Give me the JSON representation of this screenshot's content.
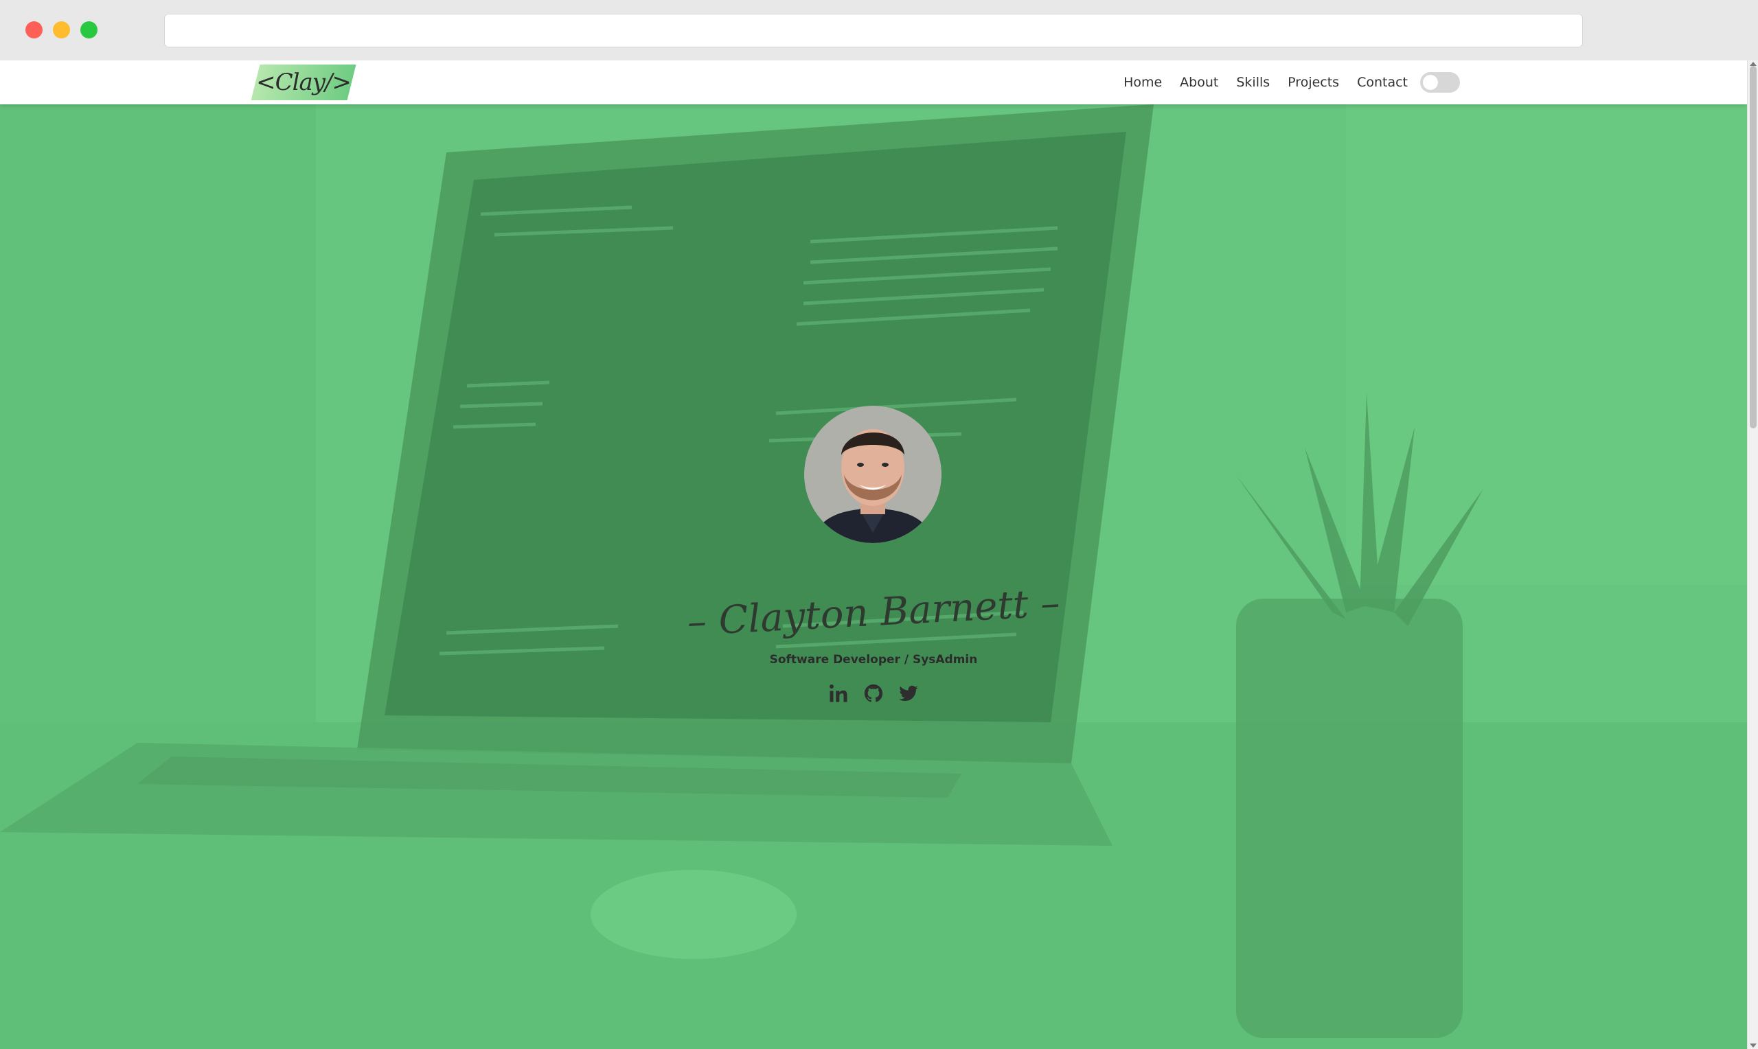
{
  "browser": {
    "address_value": "",
    "address_placeholder": ""
  },
  "navbar": {
    "logo_text": "<Clay/>",
    "links": [
      "Home",
      "About",
      "Skills",
      "Projects",
      "Contact"
    ],
    "theme_toggle": {
      "state": "off"
    }
  },
  "hero": {
    "name": "– Clayton Barnett –",
    "role": "Software Developer / SysAdmin",
    "socials": [
      {
        "name": "linkedin",
        "icon": "linkedin-icon"
      },
      {
        "name": "github",
        "icon": "github-icon"
      },
      {
        "name": "twitter",
        "icon": "twitter-icon"
      }
    ]
  },
  "colors": {
    "hero_overlay": "#63c47c",
    "logo_gradient_start": "#b6e7ad",
    "logo_gradient_end": "#6fcc83",
    "nav_text": "#333333"
  }
}
